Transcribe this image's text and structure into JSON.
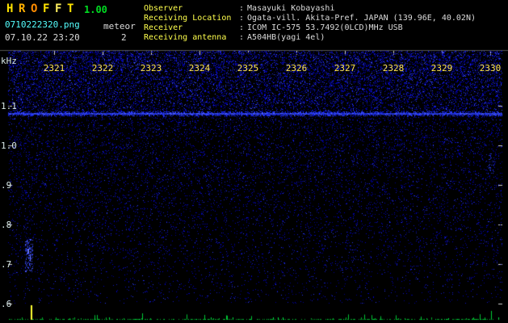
{
  "colon": ":",
  "header": {
    "title_letters": [
      {
        "ch": "H",
        "color": "#ffe400"
      },
      {
        "ch": "R",
        "color": "#ffb000"
      },
      {
        "ch": "O",
        "color": "#ff8c00"
      },
      {
        "ch": "F",
        "color": "#ffe400"
      },
      {
        "ch": "F",
        "color": "#fff060"
      },
      {
        "ch": "T",
        "color": "#ffe400"
      }
    ],
    "version": "1.00",
    "filename": "0710222320.png",
    "datetime": "07.10.22 23:20",
    "meteor_label": "meteor",
    "meteor_count": "2",
    "info": [
      {
        "label": "Observer",
        "value": "Masayuki Kobayashi"
      },
      {
        "label": "Receiving Location",
        "value": "Ogata-vill. Akita-Pref. JAPAN (139.96E, 40.02N)"
      },
      {
        "label": "Receiver",
        "value": "ICOM IC-575 53.7492(0LCD)MHz USB"
      },
      {
        "label": "Receiving antenna",
        "value": "A504HB(yagi 4el)"
      }
    ]
  },
  "chart_data": {
    "type": "heatmap",
    "title": "HROFFT 1.00 radio meteor observation spectrogram",
    "x_ticks": [
      "2321",
      "2322",
      "2323",
      "2324",
      "2325",
      "2326",
      "2327",
      "2328",
      "2329",
      "2330"
    ],
    "y_axis_unit": "kHz",
    "y_ticks": [
      "1.1",
      "1.0",
      ".9",
      ".8",
      ".7",
      ".6"
    ],
    "y_range_khz": [
      0.6,
      1.25
    ],
    "carrier_line_khz": 1.08,
    "meteor_count": 2,
    "meteor_events": [
      {
        "near_x_tick": "2321",
        "freq_khz": 0.75,
        "spike": "tall-yellow"
      },
      {
        "near_x_tick": "2330",
        "freq_khz": null,
        "spike": "small-green"
      }
    ],
    "legend_position": "none",
    "grid": false,
    "colors": {
      "noise_blue": "#0000c8",
      "carrier_blue": "#3344ee",
      "level_baseline_green": "#00b030",
      "meteor_spike_yellow": "#ffff33"
    }
  },
  "colors": {
    "background": "#000000",
    "label_yellow": "#ffff4d",
    "value_gray": "#dcdcdc",
    "filename_cyan": "#55ffff",
    "axis_white": "#d8e8e8",
    "time_yellow": "#ffe44d",
    "version_green": "#00dd22"
  }
}
